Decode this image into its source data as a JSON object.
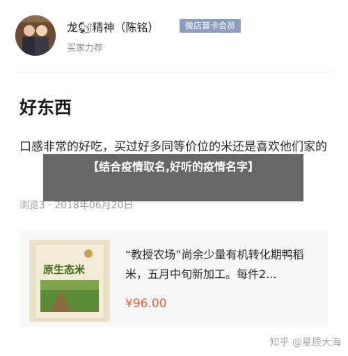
{
  "author": {
    "name": "龙🐿精神（陈铭）",
    "badge": "微店普卡会员",
    "subtitle": "买家力荐"
  },
  "post": {
    "title": "好东西",
    "body": "口感非常的好吃，买过好多同等价位的米还是喜欢他们家的",
    "meta": "浏览3 · 2018年06月20日"
  },
  "overlay_caption": "【结合疫情取名,好听的疫情名字】",
  "product": {
    "image_text": "原生态米",
    "description": "“教授农场”尚余少量有机转化期鸭稻米，五月中旬新加工。每件2...",
    "price": "¥96.00"
  },
  "footer": {
    "credit": "知乎 @星辰大海"
  },
  "colors": {
    "badge": "#8e9cc2",
    "price": "#e25d3a",
    "overlay": "#464646"
  }
}
